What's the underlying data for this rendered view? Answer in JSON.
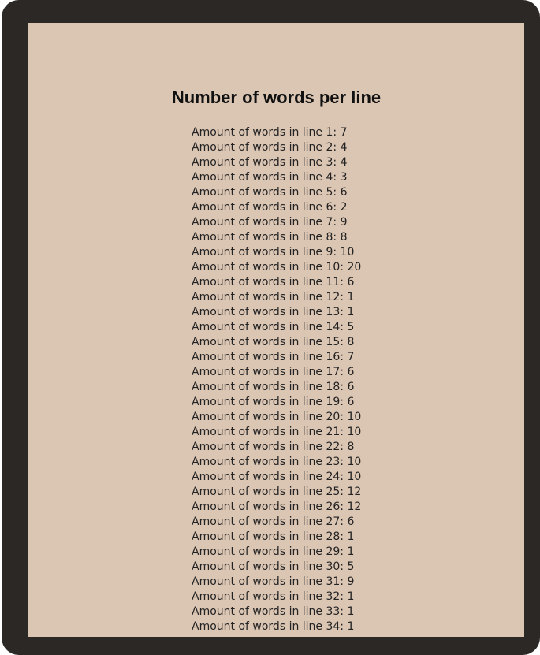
{
  "page": {
    "title": "Number of words per line",
    "line_prefix": "Amount of words in line",
    "lines": [
      {
        "label": "Amount of words in line 1: 7"
      },
      {
        "label": "Amount of words in line 2: 4"
      },
      {
        "label": "Amount of words in line 3: 4"
      },
      {
        "label": "Amount of words in line 4: 3"
      },
      {
        "label": "Amount of words in line 5: 6"
      },
      {
        "label": "Amount of words in line 6: 2"
      },
      {
        "label": "Amount of words in line 7: 9"
      },
      {
        "label": "Amount of words in line 8: 8"
      },
      {
        "label": "Amount of words in line 9: 10"
      },
      {
        "label": "Amount of words in line 10: 20"
      },
      {
        "label": "Amount of words in line 11: 6"
      },
      {
        "label": "Amount of words in line 12: 1"
      },
      {
        "label": "Amount of words in line 13: 1"
      },
      {
        "label": "Amount of words in line 14: 5"
      },
      {
        "label": "Amount of words in line 15: 8"
      },
      {
        "label": "Amount of words in line 16: 7"
      },
      {
        "label": "Amount of words in line 17: 6"
      },
      {
        "label": "Amount of words in line 18: 6"
      },
      {
        "label": "Amount of words in line 19: 6"
      },
      {
        "label": "Amount of words in line 20: 10"
      },
      {
        "label": "Amount of words in line 21: 10"
      },
      {
        "label": "Amount of words in line 22: 8"
      },
      {
        "label": "Amount of words in line 23: 10"
      },
      {
        "label": "Amount of words in line 24: 10"
      },
      {
        "label": "Amount of words in line 25: 12"
      },
      {
        "label": "Amount of words in line 26: 12"
      },
      {
        "label": "Amount of words in line 27: 6"
      },
      {
        "label": "Amount of words in line 28: 1"
      },
      {
        "label": "Amount of words in line 29: 1"
      },
      {
        "label": "Amount of words in line 30: 5"
      },
      {
        "label": "Amount of words in line 31: 9"
      },
      {
        "label": "Amount of words in line 32: 1"
      },
      {
        "label": "Amount of words in line 33: 1"
      },
      {
        "label": "Amount of words in line 34: 1"
      }
    ]
  },
  "colors": {
    "frame": "#2c2826",
    "panel": "#dbc5b3",
    "text": "#222222",
    "title": "#111111"
  }
}
